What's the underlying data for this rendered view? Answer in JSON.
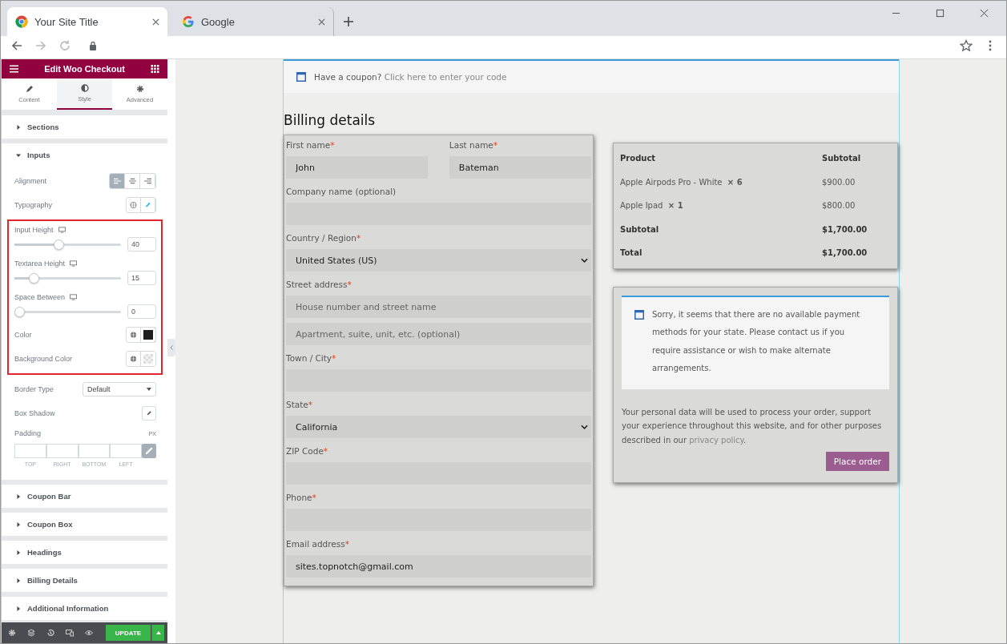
{
  "browser": {
    "tabs": [
      {
        "title": "Your Site Title",
        "selected": true
      },
      {
        "title": "Google",
        "selected": false
      }
    ]
  },
  "panel": {
    "title": "Edit Woo Checkout",
    "tabs": [
      {
        "label": "Content",
        "selected": false
      },
      {
        "label": "Style",
        "selected": true
      },
      {
        "label": "Advanced",
        "selected": false
      }
    ],
    "sections": [
      {
        "label": "Sections",
        "expanded": false
      },
      {
        "label": "Inputs",
        "expanded": true,
        "controls": [
          {
            "kind": "align",
            "label": "Alignment",
            "options": [
              {
                "selected": true
              },
              {
                "selected": false
              },
              {
                "selected": false
              }
            ]
          },
          {
            "kind": "typography",
            "label": "Typography"
          },
          {
            "kind": "highlight",
            "controls": [
              {
                "kind": "slider",
                "label": "Input Height",
                "level": 0.41,
                "value": "40"
              },
              {
                "kind": "slider",
                "label": "Textarea Height",
                "level": 0.15,
                "value": "15"
              },
              {
                "kind": "slider",
                "label": "Space Between",
                "level": 0,
                "value": "0"
              },
              {
                "kind": "color",
                "label": "Color",
                "color": "#1e1e1e"
              },
              {
                "kind": "color",
                "label": "Background Color"
              }
            ]
          },
          {
            "kind": "select",
            "label": "Border Type",
            "value": "Default"
          },
          {
            "kind": "shadow",
            "label": "Box Shadow"
          },
          {
            "kind": "padding",
            "label": "Padding",
            "unit": "PX",
            "sides": [
              "TOP",
              "RIGHT",
              "BOTTOM",
              "LEFT"
            ]
          }
        ]
      },
      {
        "label": "Coupon Bar",
        "expanded": false
      },
      {
        "label": "Coupon Box",
        "expanded": false
      },
      {
        "label": "Headings",
        "expanded": false
      },
      {
        "label": "Billing Details",
        "expanded": false
      },
      {
        "label": "Additional Information",
        "expanded": false
      }
    ],
    "update": "UPDATE"
  },
  "coupon": {
    "question": "Have a coupon?",
    "link": "Click here to enter your code"
  },
  "billing": {
    "heading": "Billing details",
    "fields": [
      {
        "label": "First name",
        "mark": "*",
        "half": true,
        "kind": "text",
        "inputs": [
          {
            "value": "John"
          }
        ]
      },
      {
        "label": "Last name",
        "mark": "*",
        "half": true,
        "kind": "text",
        "inputs": [
          {
            "value": "Bateman"
          }
        ]
      },
      {
        "label": "Company name (optional)",
        "half": false,
        "kind": "text"
      },
      {
        "label": "Country / Region",
        "mark": "*",
        "half": false,
        "kind": "select",
        "inputs": [
          {
            "value": "United States (US)"
          }
        ]
      },
      {
        "label": "Street address",
        "mark": "*",
        "half": false,
        "kind": "text",
        "inputs": [
          {
            "placeholder": "House number and street name"
          },
          {
            "placeholder": "Apartment, suite, unit, etc. (optional)"
          }
        ]
      },
      {
        "label": "Town / City",
        "mark": "*",
        "half": false,
        "kind": "text"
      },
      {
        "label": "State",
        "mark": "*",
        "half": false,
        "kind": "select",
        "inputs": [
          {
            "value": "California"
          }
        ]
      },
      {
        "label": "ZIP Code",
        "mark": "*",
        "half": false,
        "kind": "text"
      },
      {
        "label": "Phone",
        "mark": "*",
        "half": false,
        "kind": "text"
      },
      {
        "label": "Email address",
        "mark": "*",
        "half": false,
        "kind": "text",
        "inputs": [
          {
            "value": "sites.topnotch@gmail.com"
          }
        ]
      }
    ]
  },
  "order": {
    "columns": [
      "Product",
      "Subtotal"
    ],
    "rows": [
      {
        "product": "Apple Airpods Pro - White",
        "qty": "× 6",
        "amount": "$900.00",
        "bold": false
      },
      {
        "product": "Apple Ipad",
        "qty": "× 1",
        "amount": "$800.00",
        "bold": false
      },
      {
        "product": "Subtotal",
        "amount": "$1,700.00",
        "bold": true
      },
      {
        "product": "Total",
        "amount": "$1,700.00",
        "bold": true
      }
    ]
  },
  "payment": {
    "notice": "Sorry, it seems that there are no available payment methods for your state. Please contact us if you require assistance or wish to make alternate arrangements.",
    "privacy": "Your personal data will be used to process your order, support your experience throughout this website, and for other purposes described in our",
    "privacy_link": "privacy policy",
    "privacy_end": ".",
    "button": "Place order"
  }
}
